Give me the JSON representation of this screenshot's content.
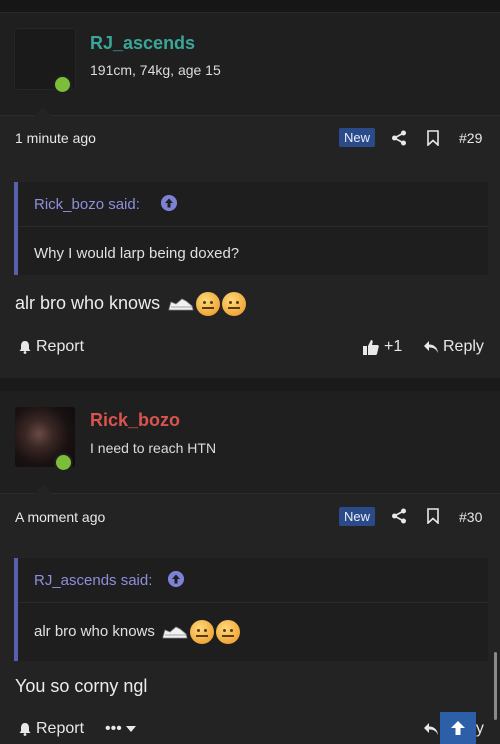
{
  "posts": [
    {
      "username": "RJ_ascends",
      "user_title": "191cm, 74kg, age 15",
      "time": "1 minute ago",
      "badge": "New",
      "number": "#29",
      "quote": {
        "author": "Rick_bozo said:",
        "text": "Why I would larp being doxed?"
      },
      "text": "alr bro who knows",
      "report": "Report",
      "likes": "+1",
      "reply": "Reply"
    },
    {
      "username": "Rick_bozo",
      "user_title": "I need to reach HTN",
      "time": "A moment ago",
      "badge": "New",
      "number": "#30",
      "quote": {
        "author": "RJ_ascends said:",
        "text": "alr bro who knows"
      },
      "text": "You so corny ngl",
      "report": "Report",
      "more": "•••",
      "reply": "Reply"
    }
  ],
  "colors": {
    "online": "#7cbe3a",
    "username_1": "#3aa69a",
    "username_2": "#d9534f",
    "quote_bar": "#5960b0",
    "badge_bg": "#2b4a8a"
  }
}
